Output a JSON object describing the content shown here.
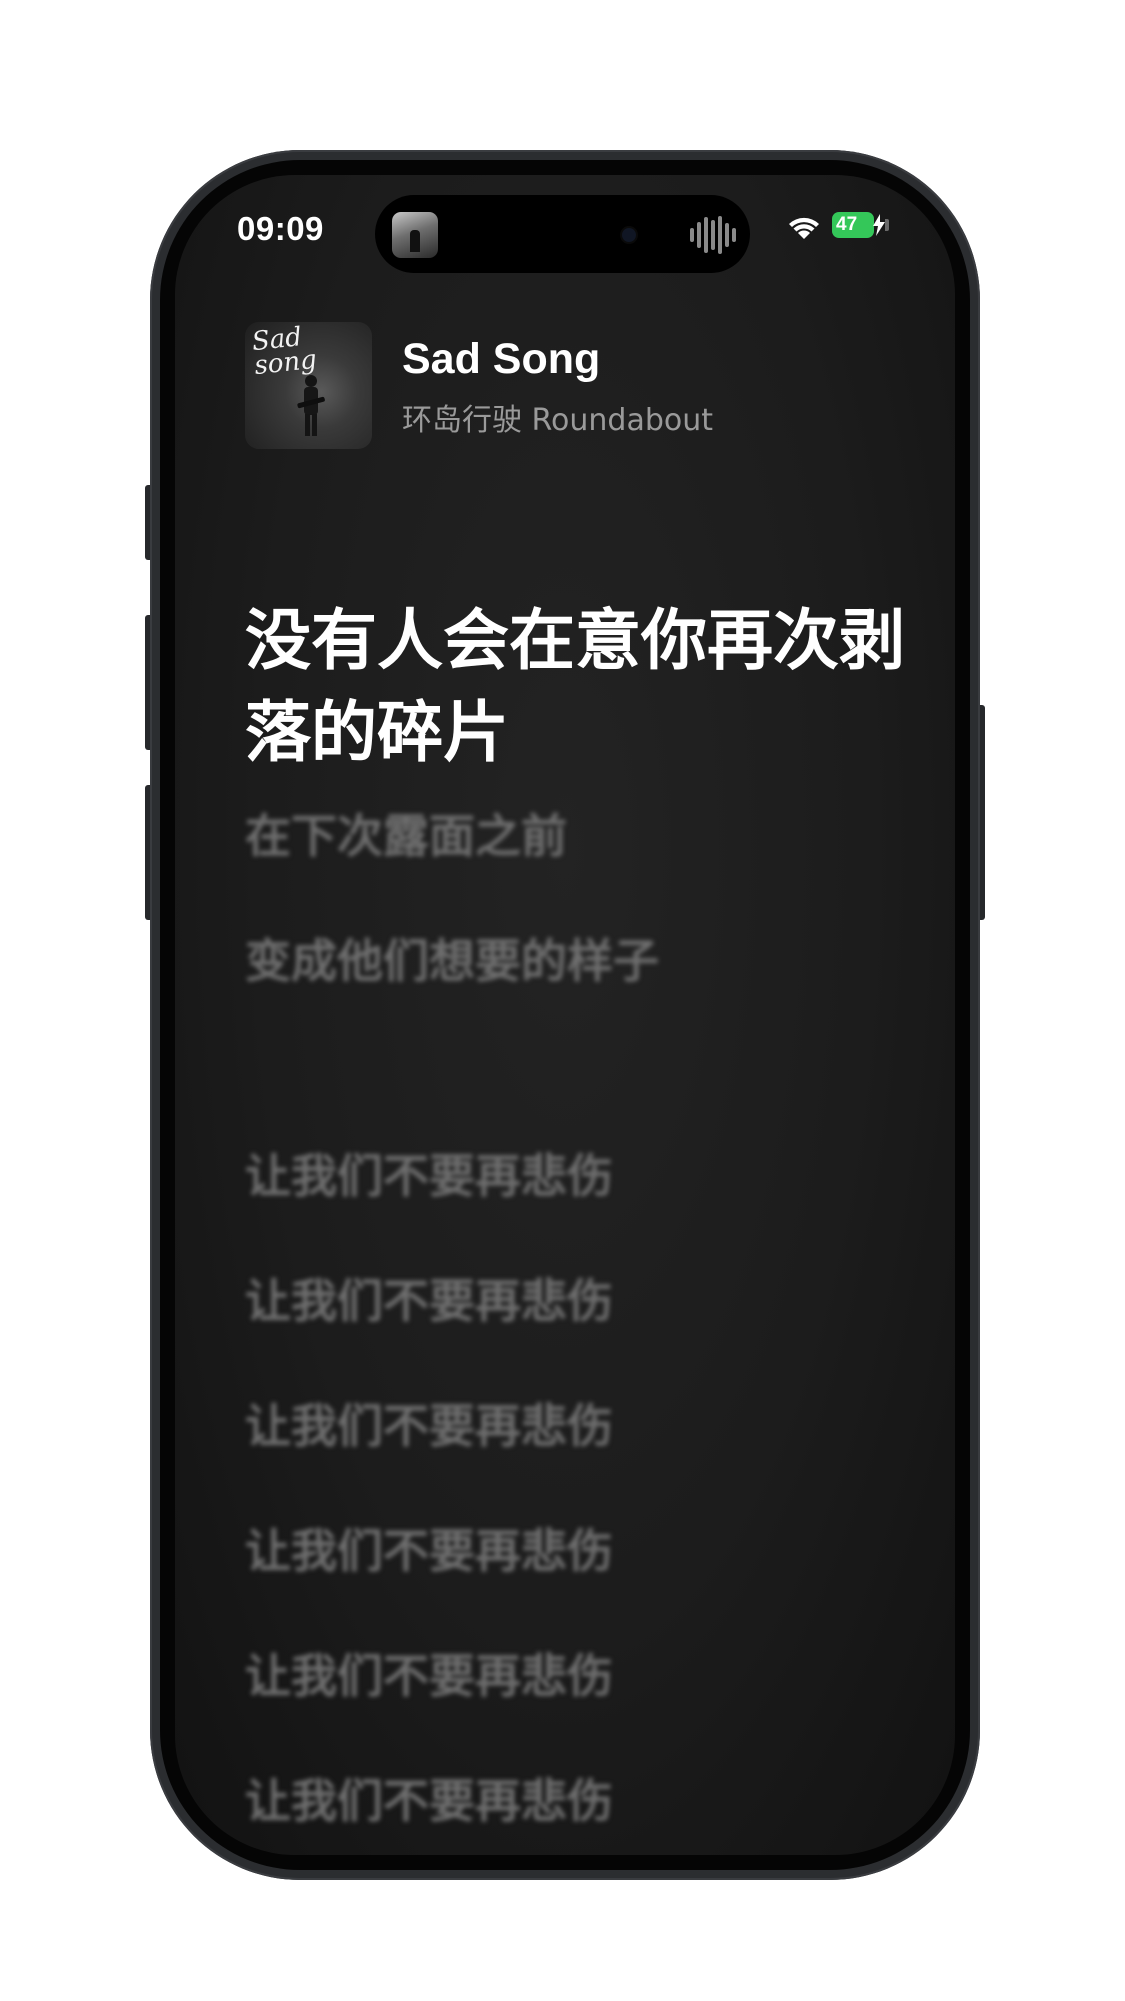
{
  "status_bar": {
    "time": "09:09",
    "battery_level": "47",
    "charging": true,
    "battery_color": "#34c759",
    "icons": [
      "wifi-icon",
      "battery-icon",
      "charging-bolt-icon"
    ]
  },
  "dynamic_island": {
    "artwork": "album-artwork-thumbnail",
    "activity_icon": "audio-waveform-icon"
  },
  "now_playing": {
    "title": "Sad Song",
    "artist": "环岛行驶 Roundabout",
    "artwork_script_text": "Sad song"
  },
  "lyrics": {
    "current": "没有人会在意你再次剥落的碎片",
    "upcoming": [
      "在下次露面之前",
      "变成他们想要的样子",
      "让我们不要再悲伤",
      "让我们不要再悲伤",
      "让我们不要再悲伤",
      "让我们不要再悲伤",
      "让我们不要再悲伤",
      "让我们不要再悲伤"
    ]
  },
  "colors": {
    "background": "#1c1c1c",
    "active_lyric": "#ffffff",
    "inactive_lyric": "#6f6f6f",
    "secondary_text": "#9a9a9a"
  }
}
